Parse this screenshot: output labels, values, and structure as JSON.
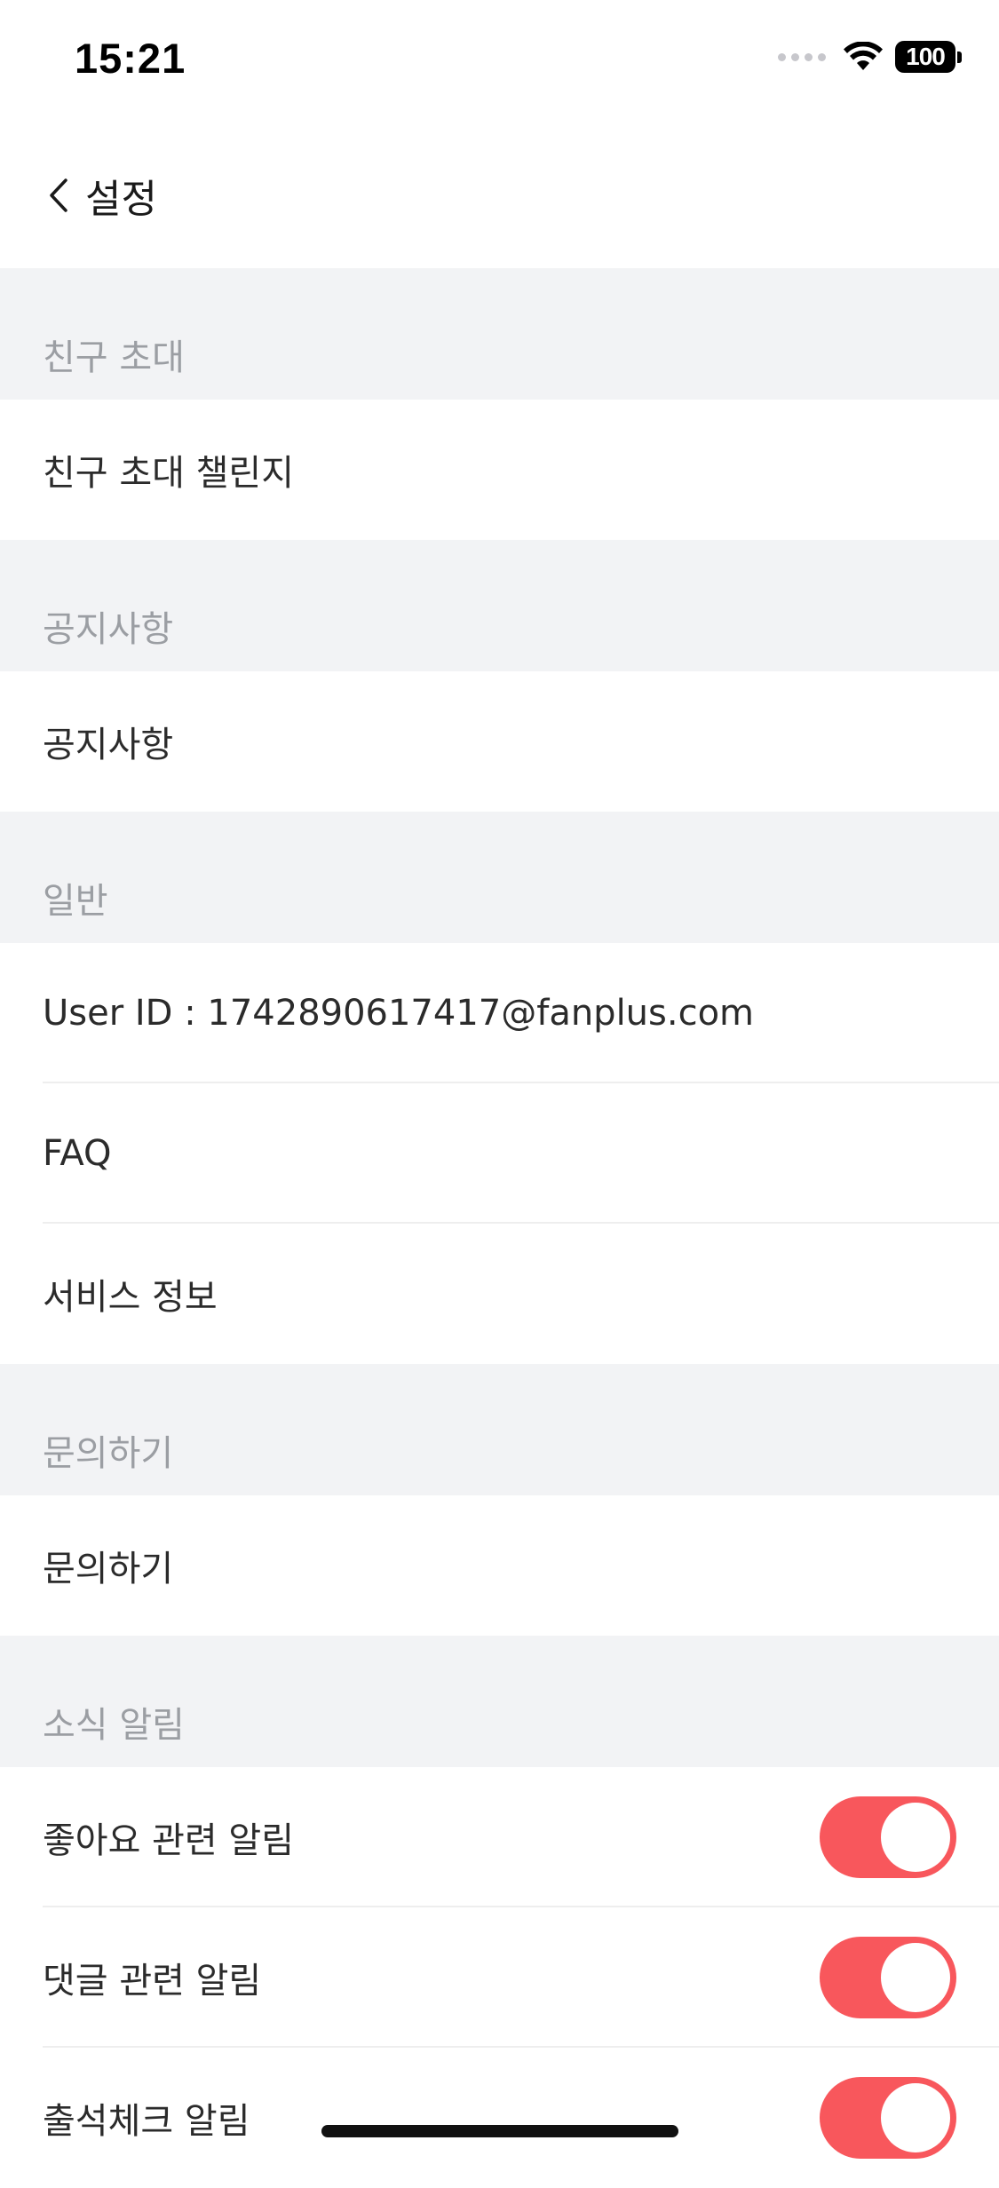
{
  "status_bar": {
    "time": "15:21",
    "battery": "100",
    "wifi_icon": "wifi-icon",
    "signal_icon": "cellular-signal-icon"
  },
  "nav": {
    "back_icon": "chevron-left-icon",
    "title": "설정"
  },
  "sections": [
    {
      "header": "친구 초대",
      "items": [
        {
          "label": "친구 초대 챌린지"
        }
      ]
    },
    {
      "header": "공지사항",
      "items": [
        {
          "label": "공지사항"
        }
      ]
    },
    {
      "header": "일반",
      "items": [
        {
          "label": "User ID : 1742890617417@fanplus.com"
        },
        {
          "label": "FAQ"
        },
        {
          "label": "서비스 정보"
        }
      ]
    },
    {
      "header": "문의하기",
      "items": [
        {
          "label": "문의하기"
        }
      ]
    },
    {
      "header": "소식 알림",
      "items": [
        {
          "label": "좋아요 관련 알림",
          "toggle": true
        },
        {
          "label": "댓글 관련 알림",
          "toggle": true
        },
        {
          "label": "출석체크 알림",
          "toggle": true
        }
      ]
    }
  ],
  "colors": {
    "accent": "#f8575c",
    "section_bg": "#f2f3f5",
    "section_text": "#9b9ea3"
  }
}
